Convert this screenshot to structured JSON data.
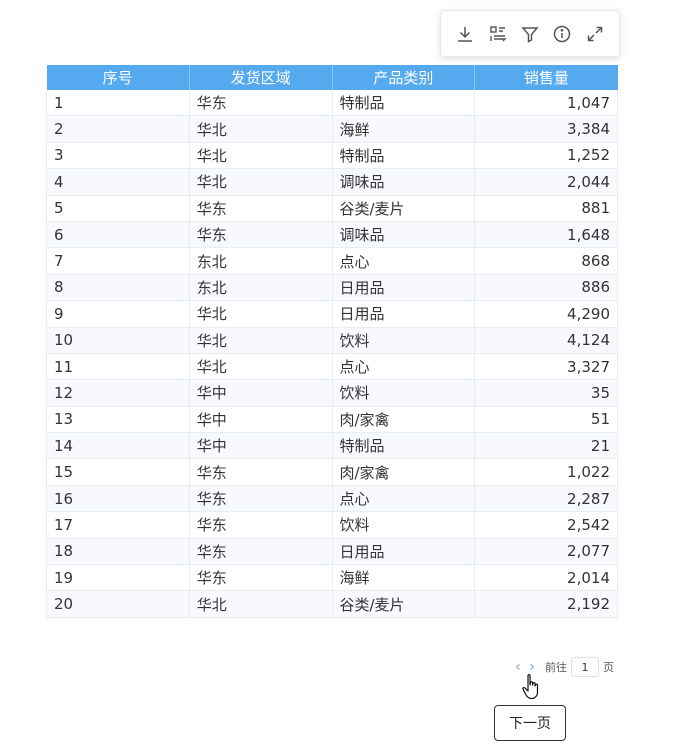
{
  "toolbar": {
    "icons": [
      "download-icon",
      "layout-icon",
      "filter-icon",
      "info-icon",
      "fullscreen-icon"
    ]
  },
  "table": {
    "headers": [
      "序号",
      "发货区域",
      "产品类别",
      "销售量"
    ],
    "header_color": "#55a9ef",
    "rows": [
      [
        "1",
        "华东",
        "特制品",
        "1,047"
      ],
      [
        "2",
        "华北",
        "海鲜",
        "3,384"
      ],
      [
        "3",
        "华北",
        "特制品",
        "1,252"
      ],
      [
        "4",
        "华北",
        "调味品",
        "2,044"
      ],
      [
        "5",
        "华东",
        "谷类/麦片",
        "881"
      ],
      [
        "6",
        "华东",
        "调味品",
        "1,648"
      ],
      [
        "7",
        "东北",
        "点心",
        "868"
      ],
      [
        "8",
        "东北",
        "日用品",
        "886"
      ],
      [
        "9",
        "华北",
        "日用品",
        "4,290"
      ],
      [
        "10",
        "华北",
        "饮料",
        "4,124"
      ],
      [
        "11",
        "华北",
        "点心",
        "3,327"
      ],
      [
        "12",
        "华中",
        "饮料",
        "35"
      ],
      [
        "13",
        "华中",
        "肉/家禽",
        "51"
      ],
      [
        "14",
        "华中",
        "特制品",
        "21"
      ],
      [
        "15",
        "华东",
        "肉/家禽",
        "1,022"
      ],
      [
        "16",
        "华东",
        "点心",
        "2,287"
      ],
      [
        "17",
        "华东",
        "饮料",
        "2,542"
      ],
      [
        "18",
        "华东",
        "日用品",
        "2,077"
      ],
      [
        "19",
        "华东",
        "海鲜",
        "2,014"
      ],
      [
        "20",
        "华北",
        "谷类/麦片",
        "2,192"
      ]
    ]
  },
  "pager": {
    "prev": "‹",
    "next": "›",
    "goto_label": "前往",
    "page_value": "1",
    "page_suffix": "页"
  },
  "tooltip": {
    "text": "下一页"
  }
}
